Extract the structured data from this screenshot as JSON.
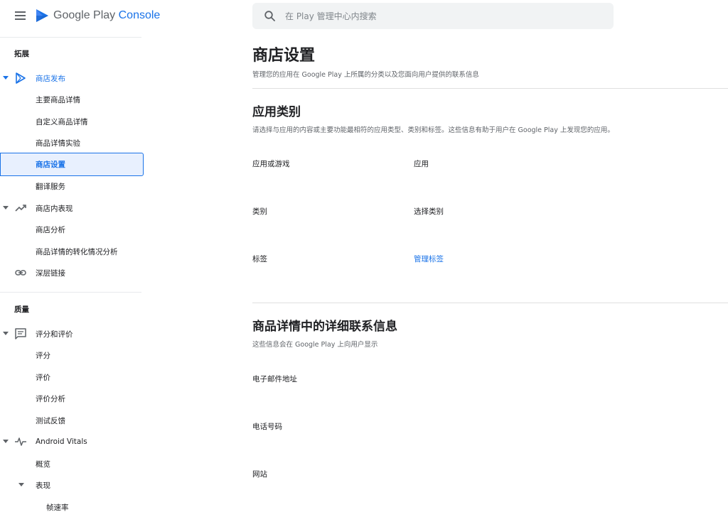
{
  "app": {
    "brand_prefix": "Google Play ",
    "brand_accent": "Console",
    "accent_color": "#1a73e8"
  },
  "search": {
    "placeholder": "在 Play 管理中心内搜索",
    "value": ""
  },
  "sidebar": {
    "section_grow": "拓展",
    "store_presence": "商店发布",
    "main_listing": "主要商品详情",
    "custom_listing": "自定义商品详情",
    "listing_experiments": "商品详情实验",
    "store_settings": "商店设置",
    "translation_service": "翻译服务",
    "store_performance": "商店内表现",
    "store_analysis": "商店分析",
    "conversion_analysis": "商品详情的转化情况分析",
    "deep_links": "深层链接",
    "section_quality": "质量",
    "ratings_reviews": "评分和评价",
    "ratings": "评分",
    "reviews": "评价",
    "review_analysis": "评价分析",
    "testing_feedback": "测试反馈",
    "android_vitals": "Android Vitals",
    "overview": "概览",
    "performance": "表现",
    "frame_rate": "帧速率"
  },
  "main": {
    "title": "商店设置",
    "subtitle": "管理您的应用在 Google Play 上所属的分类以及您面向用户提供的联系信息",
    "app_category": {
      "heading": "应用类别",
      "description": "请选择与应用的内容或主要功能最相符的应用类型、类别和标签。这些信息有助于用户在 Google Play 上发现您的应用。",
      "app_or_game_label": "应用或游戏",
      "app_or_game_value": "应用",
      "category_label": "类别",
      "category_value": "选择类别",
      "tags_label": "标签",
      "tags_link": "管理标签"
    },
    "contact": {
      "heading": "商品详情中的详细联系信息",
      "description": "这些信息会在 Google Play 上向用户显示",
      "email_label": "电子邮件地址",
      "phone_label": "电话号码",
      "website_label": "网站"
    }
  }
}
